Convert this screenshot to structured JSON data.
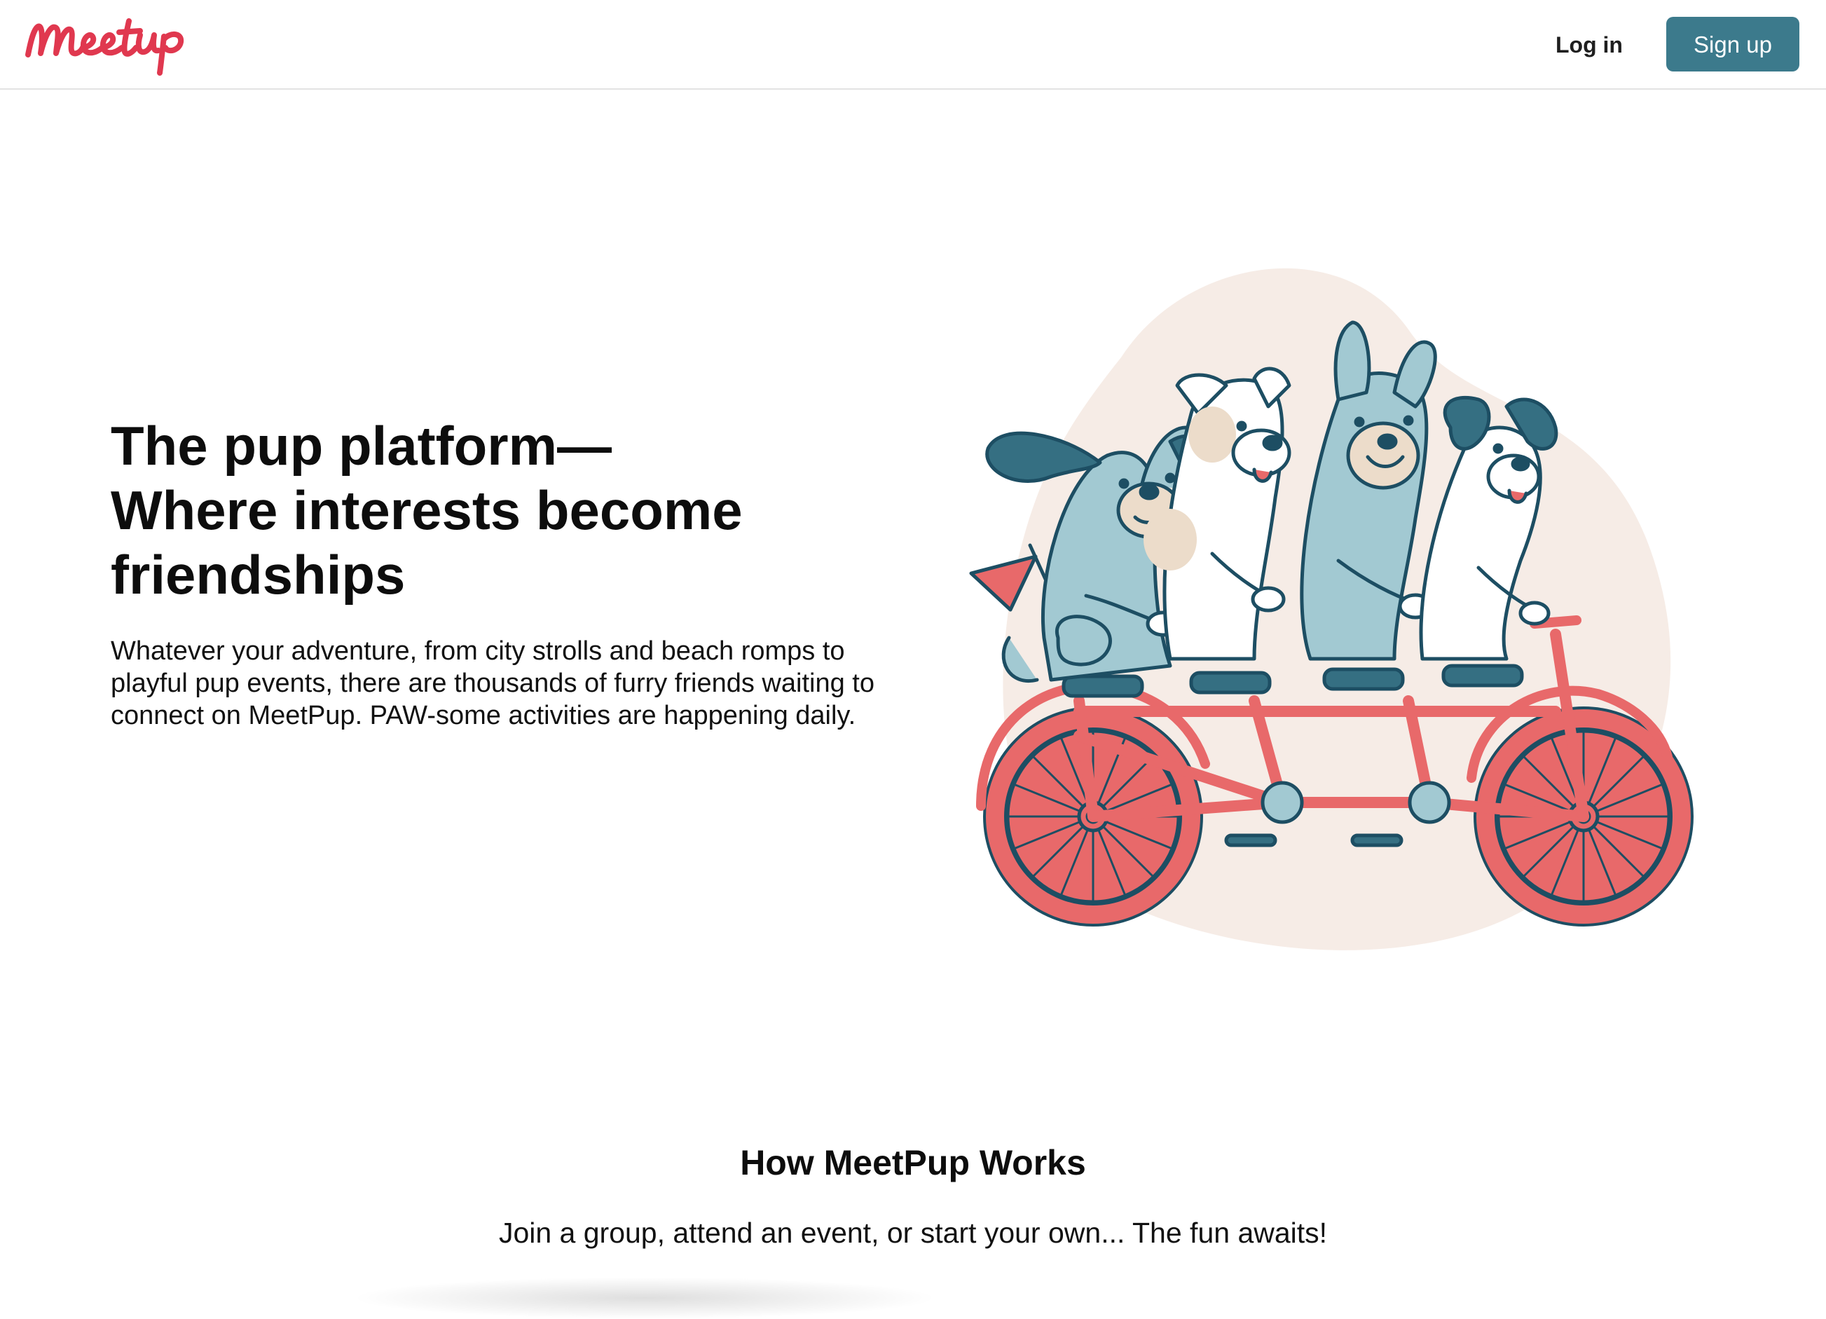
{
  "header": {
    "logo_text": "Meetup",
    "login_label": "Log in",
    "signup_label": "Sign up"
  },
  "hero": {
    "title_line1": "The pup platform—",
    "title_line2": "Where interests become",
    "title_line3": "friendships",
    "description": "Whatever your adventure, from city strolls and beach romps to playful pup events, there are thousands of furry friends waiting to connect on MeetPup. PAW-some activities are happening daily."
  },
  "how_it_works": {
    "title": "How MeetPup Works",
    "subtitle": "Join a group, attend an event, or start your own... The fun awaits!"
  },
  "colors": {
    "brand_red": "#e0384f",
    "button_teal": "#3c7a8c",
    "blob": "#f6ece6",
    "bike_red": "#e8696a",
    "outline": "#1d4e63",
    "dog_blue": "#a2c9d2",
    "dog_dark": "#356f82",
    "dog_tan": "#ecdcca"
  },
  "icons": {
    "logo": "meetup-wordmark",
    "illustration": "dogs-on-tandem-bicycle"
  }
}
